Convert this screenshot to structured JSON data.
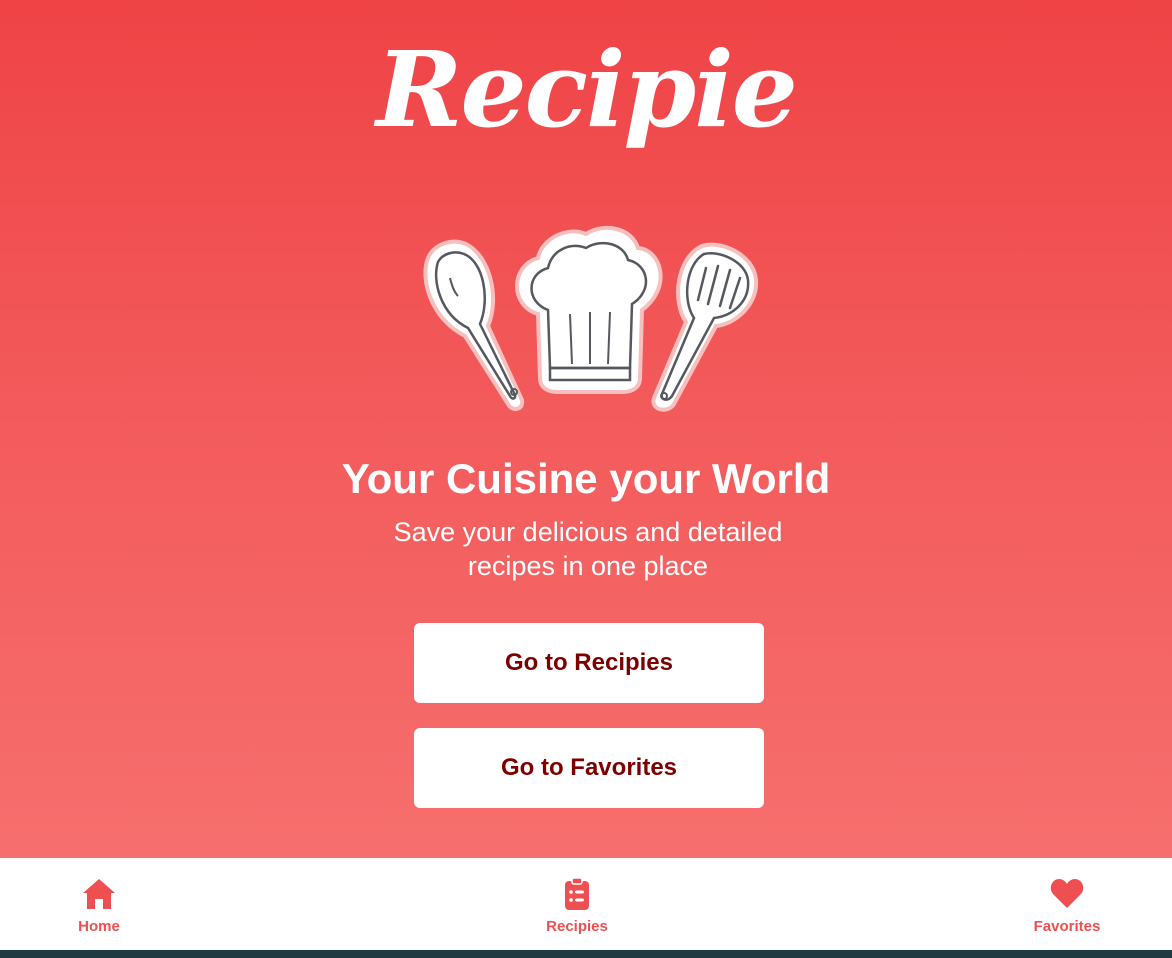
{
  "app": {
    "logo_text": "Recipie"
  },
  "hero": {
    "illustration": "chef-hat-and-spatulas-icon",
    "headline": "Your Cuisine your World",
    "subline": "Save your delicious and detailed recipes in one place"
  },
  "actions": {
    "recipies_label": "Go to Recipies",
    "favorites_label": "Go to Favorites"
  },
  "tabbar": {
    "items": [
      {
        "label": "Home",
        "icon": "home-icon"
      },
      {
        "label": "Recipies",
        "icon": "clipboard-list-icon"
      },
      {
        "label": "Favorites",
        "icon": "heart-icon"
      }
    ]
  },
  "colors": {
    "background_top": "#ef4346",
    "background_bottom": "#f66f6e",
    "button_text": "#7d0000",
    "tab_accent": "#ee4f50",
    "button_background": "#ffffff"
  }
}
